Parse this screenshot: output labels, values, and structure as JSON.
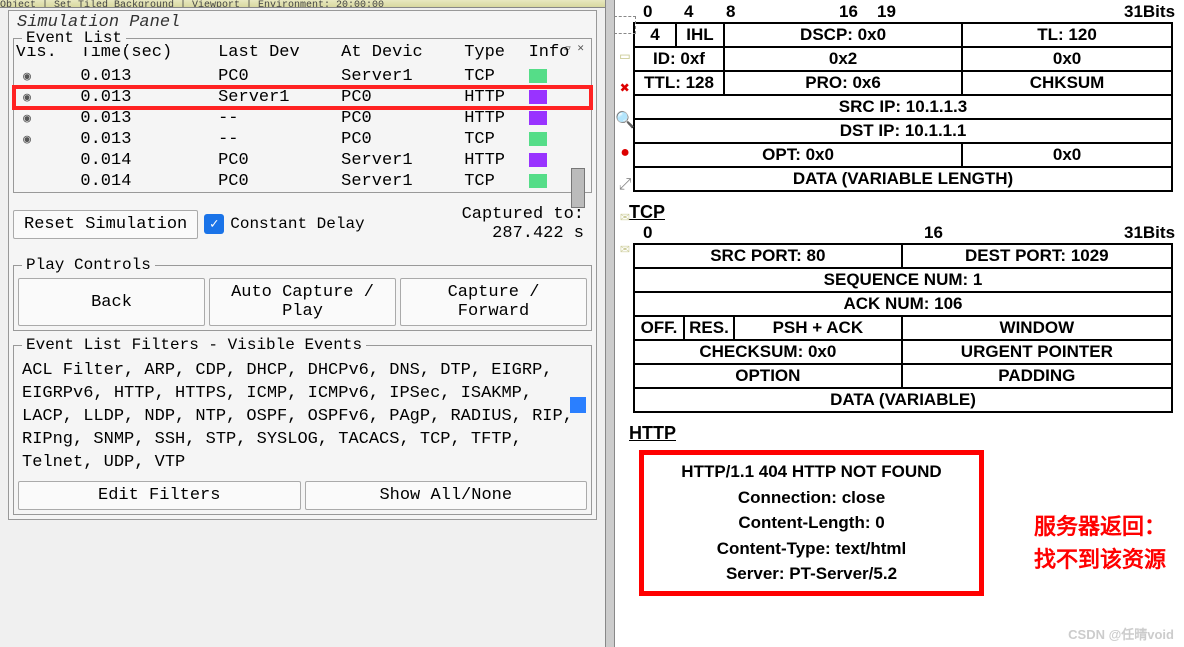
{
  "top_strip": "Object | Set Tiled Background | Viewport | Environment: 20:00:00",
  "panel_title": "Simulation Panel",
  "event_list": {
    "legend": "Event List",
    "headers": [
      "Vis.",
      "Time(sec)",
      "Last Dev",
      "At Devic",
      "Type",
      "Info"
    ],
    "rows": [
      {
        "vis": "◉",
        "time": "0.013",
        "last": "PC0",
        "at": "Server1",
        "type": "TCP",
        "color": "#55dd88",
        "hl": false
      },
      {
        "vis": "◉",
        "time": "0.013",
        "last": "Server1",
        "at": "PC0",
        "type": "HTTP",
        "color": "#9933ff",
        "hl": true
      },
      {
        "vis": "◉",
        "time": "0.013",
        "last": "--",
        "at": "PC0",
        "type": "HTTP",
        "color": "#9933ff",
        "hl": false
      },
      {
        "vis": "◉",
        "time": "0.013",
        "last": "--",
        "at": "PC0",
        "type": "TCP",
        "color": "#55dd88",
        "hl": false
      },
      {
        "vis": "",
        "time": "0.014",
        "last": "PC0",
        "at": "Server1",
        "type": "HTTP",
        "color": "#9933ff",
        "hl": false
      },
      {
        "vis": "",
        "time": "0.014",
        "last": "PC0",
        "at": "Server1",
        "type": "TCP",
        "color": "#55dd88",
        "hl": false
      }
    ]
  },
  "controls": {
    "reset": "Reset Simulation",
    "constant_delay": "Constant Delay",
    "captured_label": "Captured to:",
    "captured_value": "287.422 s"
  },
  "play": {
    "legend": "Play Controls",
    "back": "Back",
    "auto": "Auto Capture / Play",
    "fwd": "Capture / Forward"
  },
  "filters": {
    "legend": "Event List Filters - Visible Events",
    "text": "ACL Filter, ARP, CDP, DHCP, DHCPv6, DNS, DTP, EIGRP, EIGRPv6, HTTP, HTTPS, ICMP, ICMPv6, IPSec, ISAKMP, LACP, LLDP, NDP, NTP, OSPF, OSPFv6, PAgP, RADIUS, RIP, RIPng, SNMP, SSH, STP, SYSLOG, TACACS, TCP, TFTP, Telnet, UDP, VTP",
    "edit": "Edit Filters",
    "show": "Show All/None"
  },
  "ip": {
    "bits": [
      "0",
      "4",
      "8",
      "16",
      "19",
      "31Bits"
    ],
    "bit_pos": [
      14,
      55,
      97,
      210,
      248,
      495
    ],
    "r1": {
      "ver": "4",
      "ihl": "IHL",
      "dscp": "DSCP: 0x0",
      "tl": "TL: 120"
    },
    "r2": {
      "id": "ID: 0xf",
      "flags": "0x2",
      "frag": "0x0"
    },
    "r3": {
      "ttl": "TTL: 128",
      "pro": "PRO: 0x6",
      "chk": "CHKSUM"
    },
    "src": "SRC IP: 10.1.1.3",
    "dst": "DST IP: 10.1.1.1",
    "opt": "OPT: 0x0",
    "pad": "0x0",
    "data": "DATA (VARIABLE LENGTH)"
  },
  "tcp": {
    "label": "TCP",
    "bits": [
      "0",
      "16",
      "31Bits"
    ],
    "bit_pos": [
      14,
      295,
      495
    ],
    "src": "SRC PORT: 80",
    "dst": "DEST PORT: 1029",
    "seq": "SEQUENCE NUM: 1",
    "ack": "ACK NUM: 106",
    "off": "OFF.",
    "res": "RES.",
    "flags": "PSH + ACK",
    "win": "WINDOW",
    "chk": "CHECKSUM: 0x0",
    "urg": "URGENT POINTER",
    "opt": "OPTION",
    "pad": "PADDING",
    "data": "DATA (VARIABLE)"
  },
  "http": {
    "label": "HTTP",
    "lines": [
      "HTTP/1.1 404 HTTP NOT FOUND",
      "Connection: close",
      "Content-Length: 0",
      "Content-Type: text/html",
      "Server: PT-Server/5.2"
    ]
  },
  "annotation": "服务器返回：\n找不到该资源",
  "watermark": "CSDN @任晴void"
}
